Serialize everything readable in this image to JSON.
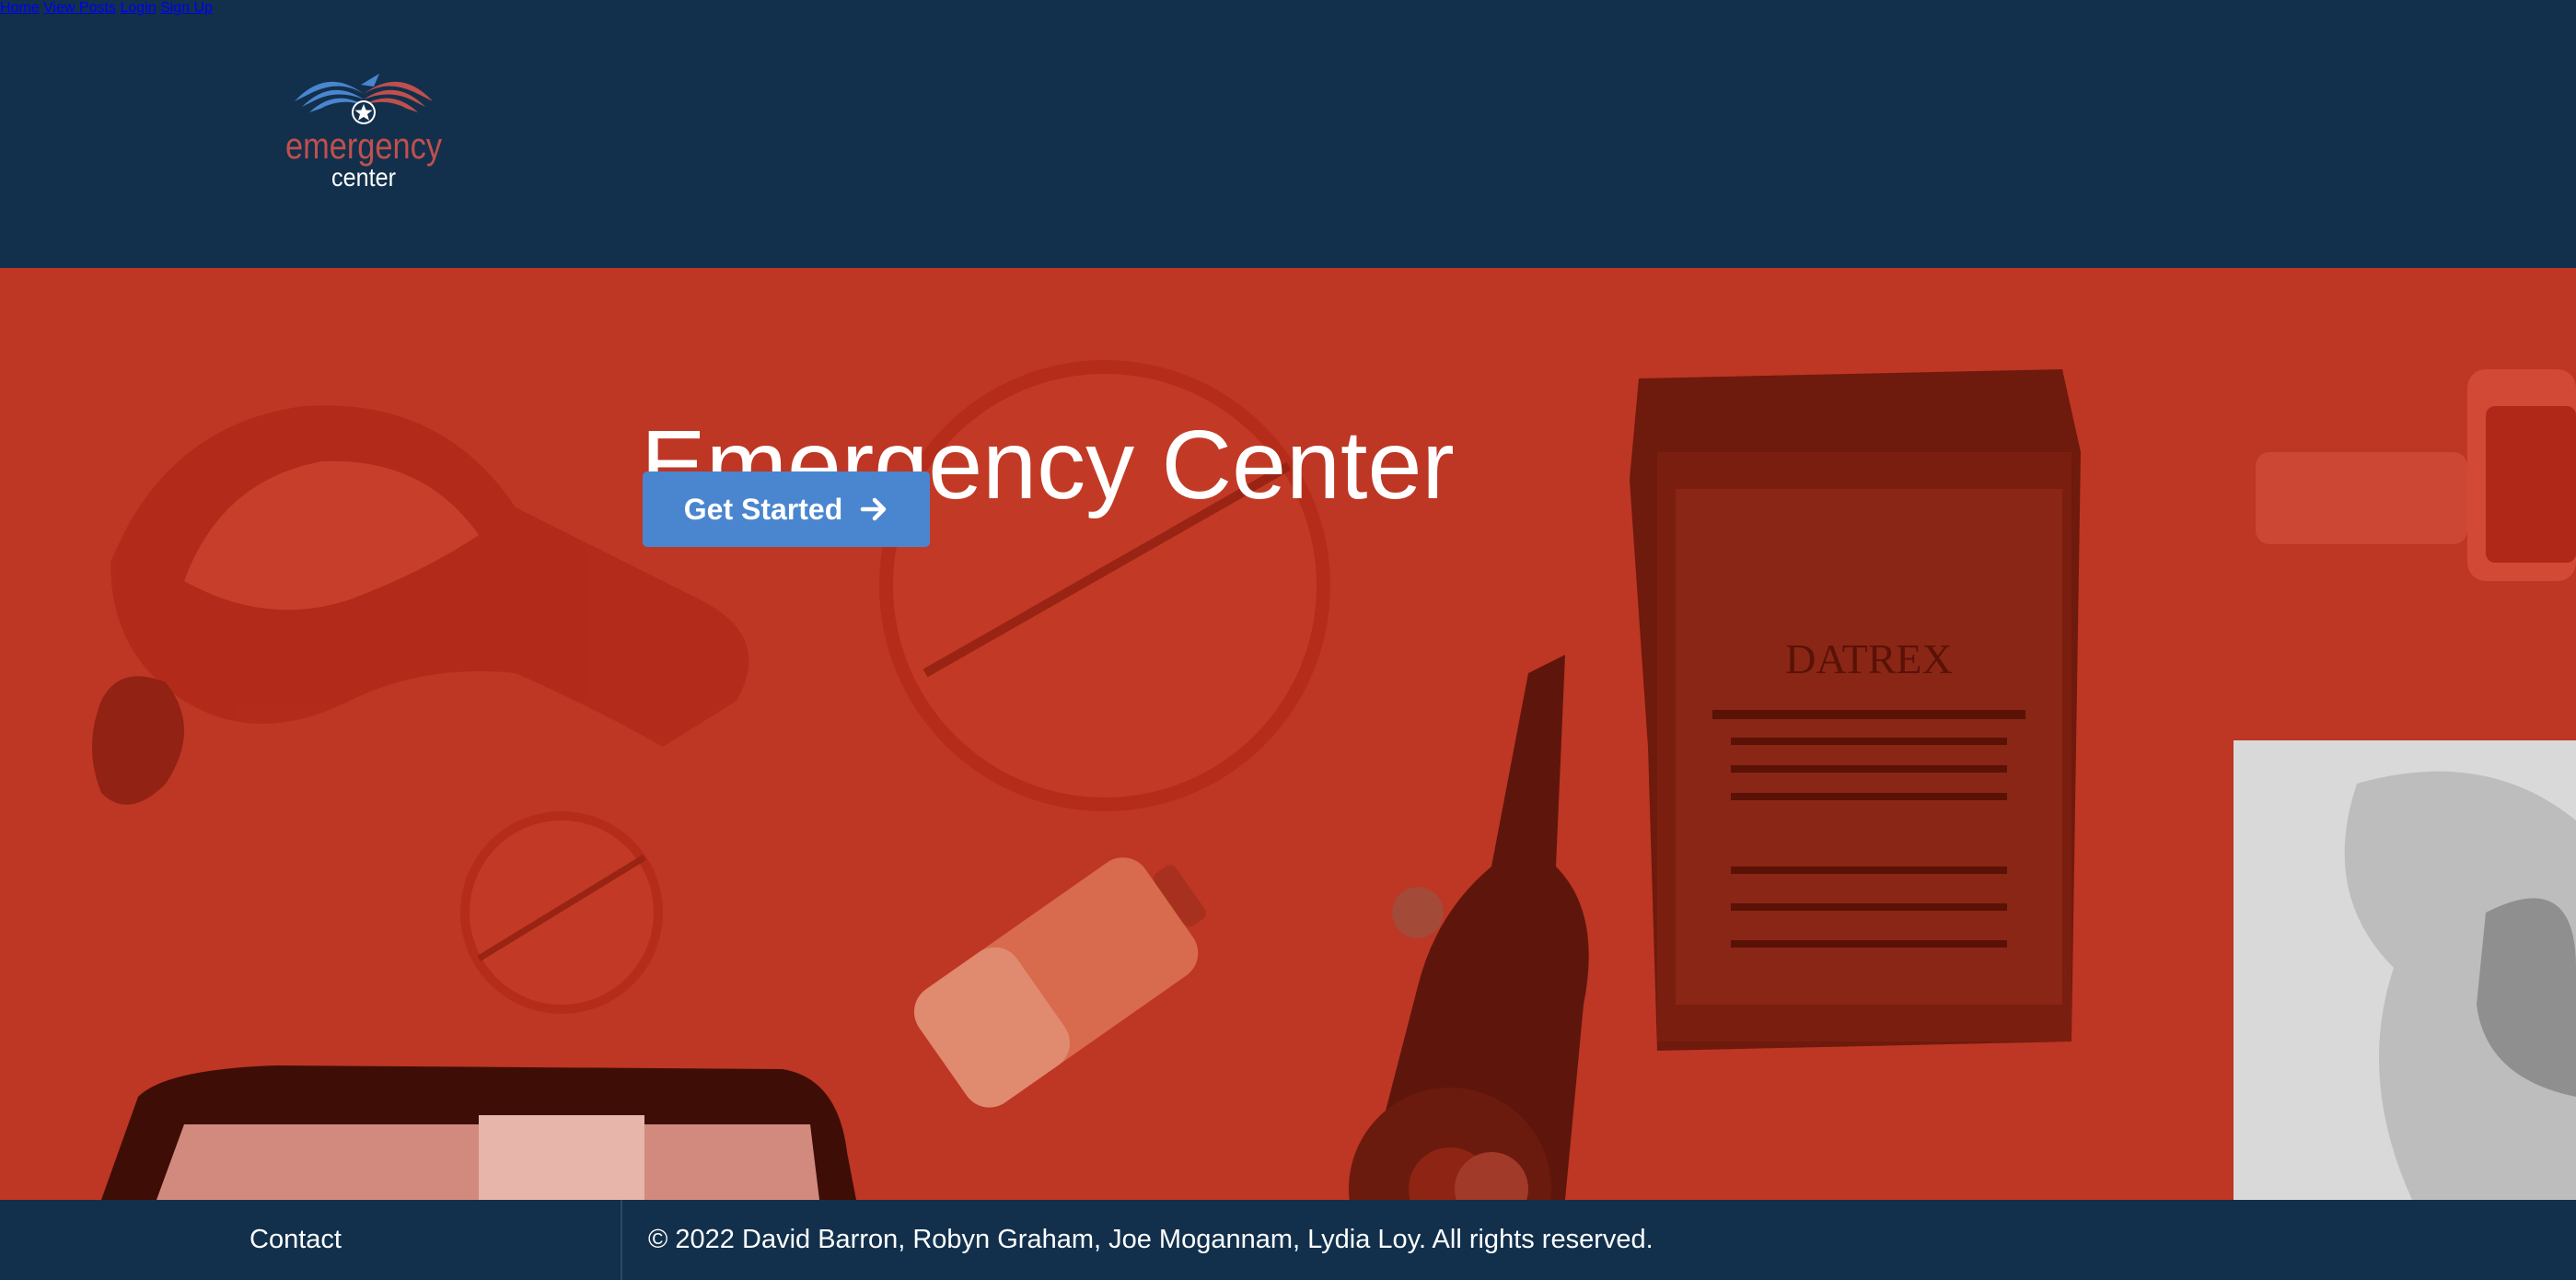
{
  "header": {
    "logo": {
      "line1": "emergency",
      "line2": "center"
    },
    "nav": [
      {
        "label": "Home"
      },
      {
        "label": "View Posts"
      },
      {
        "label": "Login"
      },
      {
        "label": "Sign Up"
      }
    ]
  },
  "hero": {
    "title": "Emergency Center",
    "cta_label": "Get Started",
    "cta_icon": "arrow-right-icon"
  },
  "footer": {
    "contact_label": "Contact",
    "copyright": "© 2022 David Barron, Robyn Graham, Joe Mogannam, Lydia Loy. All rights reserved."
  },
  "colors": {
    "navy": "#12304c",
    "hero_red": "#be3624",
    "button_blue": "#4a86cf",
    "logo_red": "#c0504d",
    "logo_blue": "#4a86cf"
  }
}
